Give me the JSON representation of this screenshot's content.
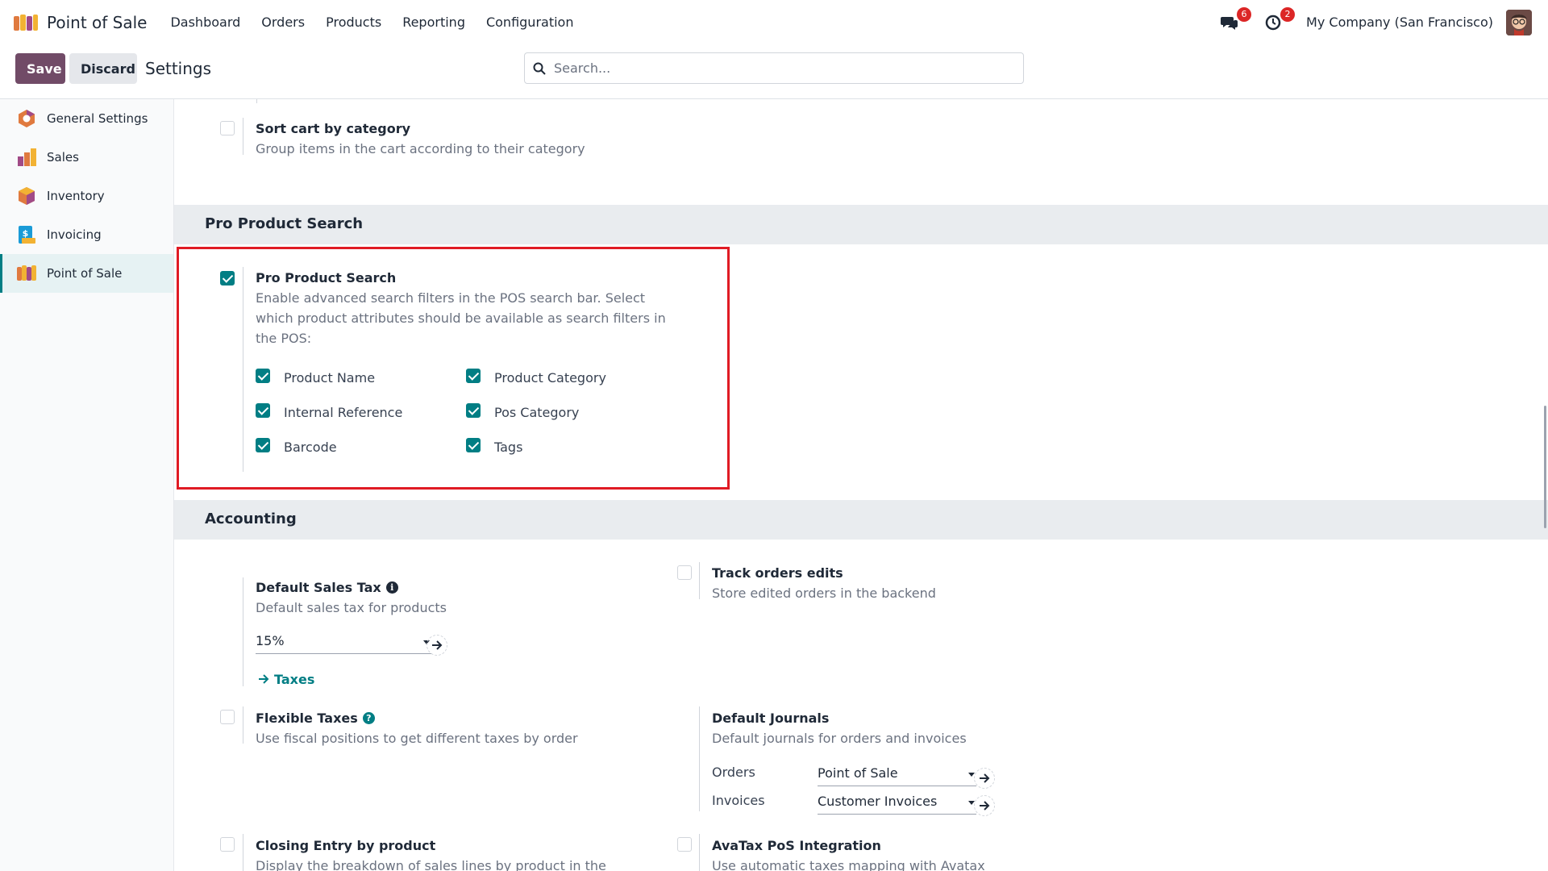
{
  "nav": {
    "app_name": "Point of Sale",
    "menu": [
      "Dashboard",
      "Orders",
      "Products",
      "Reporting",
      "Configuration"
    ],
    "messages_count": "6",
    "activities_count": "2",
    "company": "My Company (San Francisco)"
  },
  "control": {
    "save_label": "Save",
    "discard_label": "Discard",
    "title": "Settings",
    "search_placeholder": "Search..."
  },
  "sidebar": {
    "items": [
      {
        "label": "General Settings",
        "icon": "general-settings-icon"
      },
      {
        "label": "Sales",
        "icon": "sales-icon"
      },
      {
        "label": "Inventory",
        "icon": "inventory-icon"
      },
      {
        "label": "Invoicing",
        "icon": "invoicing-icon"
      },
      {
        "label": "Point of Sale",
        "icon": "point-of-sale-icon",
        "active": true
      }
    ]
  },
  "sort_cart": {
    "title": "Sort cart by category",
    "desc": "Group items in the cart according to their category"
  },
  "pro_search": {
    "section": "Pro Product Search",
    "title": "Pro Product Search",
    "desc_line1": "Enable advanced search filters in the POS search bar. Select",
    "desc_line2": "which product attributes should be available as search filters in",
    "desc_line3": "the POS:",
    "options": [
      "Product Name",
      "Product Category",
      "Internal Reference",
      "Pos Category",
      "Barcode",
      "Tags"
    ]
  },
  "accounting": {
    "section": "Accounting",
    "default_tax": {
      "title": "Default Sales Tax",
      "desc": "Default sales tax for products",
      "value": "15%",
      "link": "Taxes"
    },
    "track_edits": {
      "title": "Track orders edits",
      "desc": "Store edited orders in the backend"
    },
    "flexible_taxes": {
      "title": "Flexible Taxes",
      "desc": "Use fiscal positions to get different taxes by order"
    },
    "default_journals": {
      "title": "Default Journals",
      "desc": "Default journals for orders and invoices",
      "orders_label": "Orders",
      "orders_value": "Point of Sale",
      "invoices_label": "Invoices",
      "invoices_value": "Customer Invoices"
    },
    "closing_entry": {
      "title": "Closing Entry by product",
      "desc": "Display the breakdown of sales lines by product in the"
    },
    "avatax": {
      "title": "AvaTax PoS Integration",
      "desc": "Use automatic taxes mapping with Avatax"
    }
  },
  "colors": {
    "primary": "#714b67",
    "accent": "#017e84",
    "highlight": "#e01b24"
  }
}
